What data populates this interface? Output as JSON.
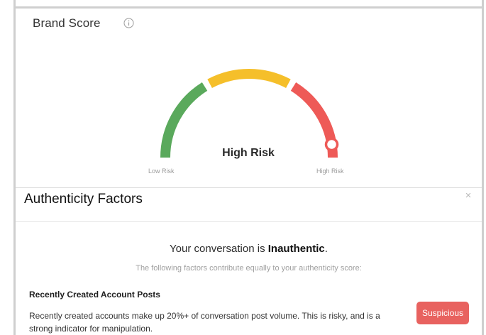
{
  "brand_score": {
    "title": "Brand Score",
    "info_icon": "info-circle-icon"
  },
  "gauge": {
    "risk_label": "High Risk",
    "scale_low": "Low Risk",
    "scale_high": "High Risk",
    "score_fraction": 0.95,
    "colors": {
      "low": "#5aa95c",
      "medium": "#f5bf2a",
      "high": "#ee5a57"
    }
  },
  "authenticity": {
    "title": "Authenticity Factors",
    "close_icon": "close-icon",
    "close_glyph": "×",
    "conversation_prefix": "Your conversation is ",
    "conversation_status": "Inauthentic",
    "conversation_suffix": ".",
    "note": "The following factors contribute equally to your authenticity score:",
    "factors": [
      {
        "title": "Recently Created Account Posts",
        "description": "Recently created accounts make up 20%+ of conversation post volume. This is risky, and is a strong indicator for manipulation.",
        "badge": "Suspicious",
        "badge_color": "#e8625f"
      }
    ]
  }
}
